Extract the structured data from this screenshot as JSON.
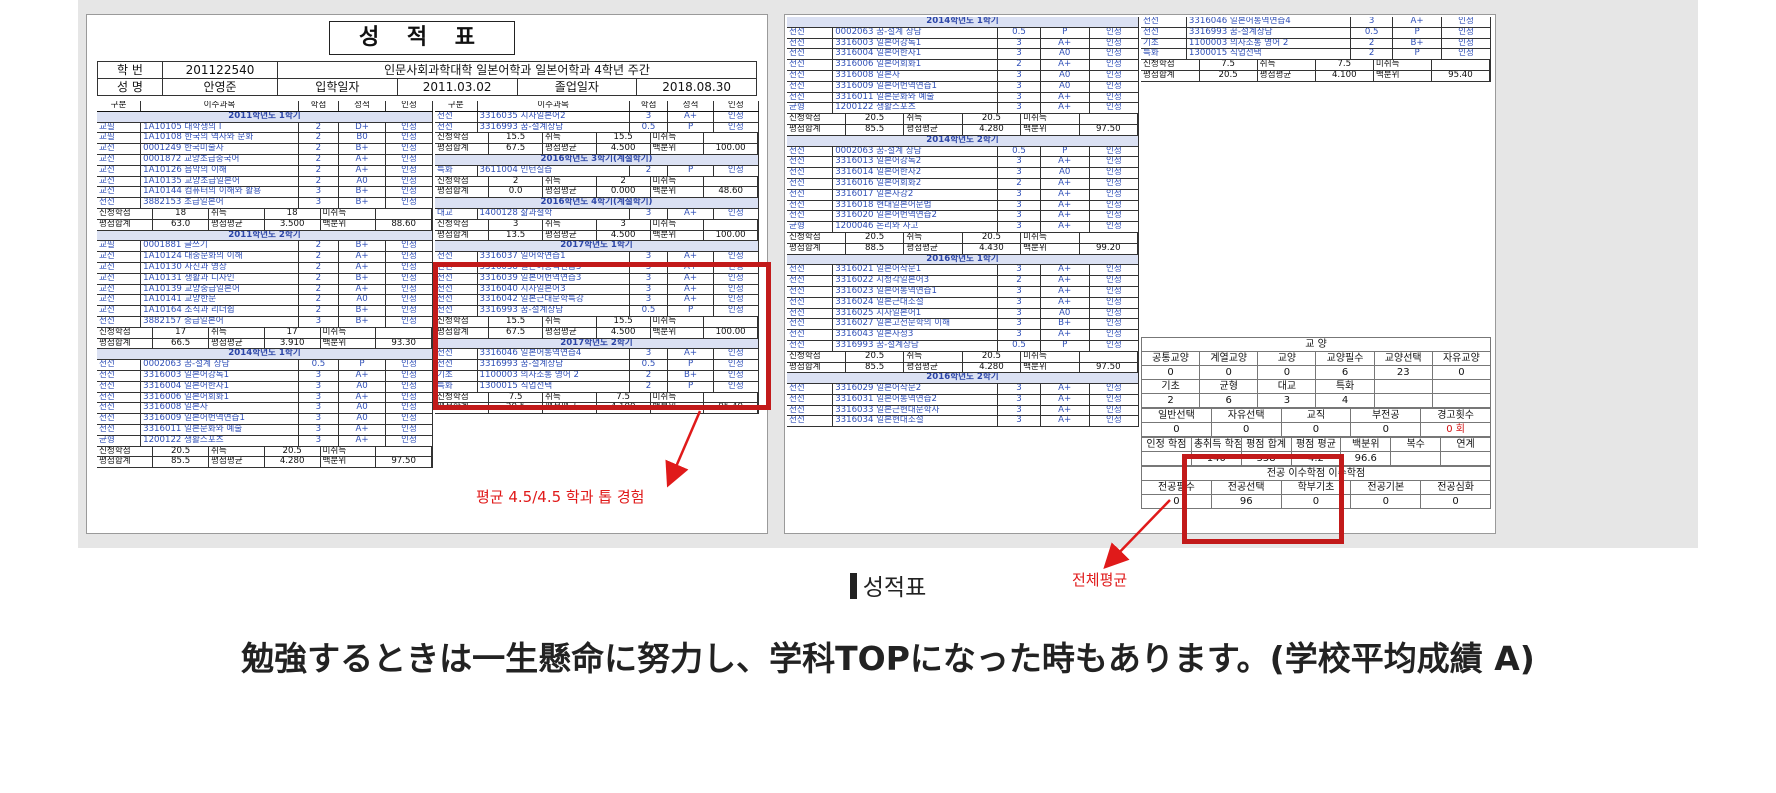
{
  "sheet_title": "성 적 표",
  "info": {
    "row1": [
      "학 번",
      "201122540",
      "인문사회과학대학 일본어학과 일본어학과 4학년 주간"
    ],
    "row2": [
      "성 명",
      "안영준",
      "입학일자",
      "2011.03.02",
      "졸업일자",
      "2018.08.30"
    ]
  },
  "col_headers": [
    "구분",
    "이수과목",
    "학점",
    "성적",
    "인정"
  ],
  "left_a": [
    {
      "t": "sem",
      "v": "2011학년도 1학기"
    },
    {
      "t": "c",
      "v": [
        "교필",
        "1A10105 대학생의 I",
        "2",
        "D+",
        "인정"
      ]
    },
    {
      "t": "c",
      "v": [
        "교필",
        "1A10108 한국의 역사와 문화",
        "2",
        "B0",
        "인정"
      ]
    },
    {
      "t": "c",
      "v": [
        "교선",
        "0001249 한국미술사",
        "2",
        "B+",
        "인정"
      ]
    },
    {
      "t": "c",
      "v": [
        "교선",
        "0001872 교양초급중국어",
        "2",
        "A+",
        "인정"
      ]
    },
    {
      "t": "c",
      "v": [
        "교선",
        "1A10126 음악의 이해",
        "2",
        "A+",
        "인정"
      ]
    },
    {
      "t": "c",
      "v": [
        "교선",
        "1A10135 교양초급일본어",
        "2",
        "A0",
        "인정"
      ]
    },
    {
      "t": "c",
      "v": [
        "교선",
        "1A10144 컴퓨터의 이해와 활용",
        "3",
        "B+",
        "인정"
      ]
    },
    {
      "t": "c",
      "v": [
        "전선",
        "3882153 초급일본어",
        "3",
        "B+",
        "인정"
      ]
    },
    {
      "t": "s",
      "v": [
        "신청학점",
        "18",
        "취득",
        "18",
        "미취득",
        ""
      ]
    },
    {
      "t": "s",
      "v": [
        "평점합계",
        "63.0",
        "평점평균",
        "3.500",
        "백분위",
        "88.60"
      ]
    },
    {
      "t": "sem",
      "v": "2011학년도 2학기"
    },
    {
      "t": "c",
      "v": [
        "교필",
        "0001881 글쓰기",
        "2",
        "B+",
        "인정"
      ]
    },
    {
      "t": "c",
      "v": [
        "교선",
        "1A10124 대중문화의 이해",
        "2",
        "A+",
        "인정"
      ]
    },
    {
      "t": "c",
      "v": [
        "교선",
        "1A10130 사진과 영상",
        "2",
        "A+",
        "인정"
      ]
    },
    {
      "t": "c",
      "v": [
        "교선",
        "1A10131 생활과 디자인",
        "2",
        "B+",
        "인정"
      ]
    },
    {
      "t": "c",
      "v": [
        "교선",
        "1A10139 교양중급일본어",
        "2",
        "A+",
        "인정"
      ]
    },
    {
      "t": "c",
      "v": [
        "교선",
        "1A10141 교양한문",
        "2",
        "A0",
        "인정"
      ]
    },
    {
      "t": "c",
      "v": [
        "교선",
        "1A10164 조직과 리더쉽",
        "2",
        "B+",
        "인정"
      ]
    },
    {
      "t": "c",
      "v": [
        "전선",
        "3882157 중급일본어",
        "3",
        "B+",
        "인정"
      ]
    },
    {
      "t": "s",
      "v": [
        "신청학점",
        "17",
        "취득",
        "17",
        "미취득",
        ""
      ]
    },
    {
      "t": "s",
      "v": [
        "평점합계",
        "66.5",
        "평점평균",
        "3.910",
        "백분위",
        "93.30"
      ]
    },
    {
      "t": "sem",
      "v": "2014학년도 1학기"
    },
    {
      "t": "c",
      "v": [
        "전선",
        "0002063 꿈-설계 상담",
        "0.5",
        "P",
        "인정"
      ]
    },
    {
      "t": "c",
      "v": [
        "전선",
        "3316003 일본어강독1",
        "3",
        "A+",
        "인정"
      ]
    },
    {
      "t": "c",
      "v": [
        "전선",
        "3316004 일본어한자1",
        "3",
        "A0",
        "인정"
      ]
    },
    {
      "t": "c",
      "v": [
        "전선",
        "3316006 일본어회화1",
        "3",
        "A+",
        "인정"
      ]
    },
    {
      "t": "c",
      "v": [
        "전선",
        "3316008 일본사",
        "3",
        "A0",
        "인정"
      ]
    },
    {
      "t": "c",
      "v": [
        "전선",
        "3316009 일본어번역연습1",
        "3",
        "A0",
        "인정"
      ]
    },
    {
      "t": "c",
      "v": [
        "전선",
        "3316011 일본문화와 예술",
        "3",
        "A+",
        "인정"
      ]
    },
    {
      "t": "c",
      "v": [
        "균형",
        "1200122 생활스포츠",
        "3",
        "A+",
        "인정"
      ]
    },
    {
      "t": "s",
      "v": [
        "신청학점",
        "20.5",
        "취득",
        "20.5",
        "미취득",
        ""
      ]
    },
    {
      "t": "s",
      "v": [
        "평점합계",
        "85.5",
        "평점평균",
        "4.280",
        "백분위",
        "97.50"
      ]
    }
  ],
  "left_b": [
    {
      "t": "c",
      "v": [
        "전선",
        "3316035 시사일본어2",
        "3",
        "A+",
        "인정"
      ]
    },
    {
      "t": "c",
      "v": [
        "전선",
        "3316993 꿈-설계상담",
        "0.5",
        "P",
        "인정"
      ]
    },
    {
      "t": "s",
      "v": [
        "신청학점",
        "15.5",
        "취득",
        "15.5",
        "미취득",
        ""
      ]
    },
    {
      "t": "s",
      "v": [
        "평점합계",
        "67.5",
        "평점평균",
        "4.500",
        "백분위",
        "100.00"
      ]
    },
    {
      "t": "sem",
      "v": "2016학년도 3학기(계절학기)"
    },
    {
      "t": "c",
      "v": [
        "특화",
        "3611004 인턴실습",
        "2",
        "P",
        "인정"
      ]
    },
    {
      "t": "s",
      "v": [
        "신청학점",
        "2",
        "취득",
        "2",
        "미취득",
        ""
      ]
    },
    {
      "t": "s",
      "v": [
        "평점합계",
        "0.0",
        "평점평균",
        "0.000",
        "백분위",
        "48.60"
      ]
    },
    {
      "t": "sem",
      "v": "2016학년도 4학기(계절학기)"
    },
    {
      "t": "c",
      "v": [
        "대교",
        "1400128 삶과철학",
        "3",
        "A+",
        "인정"
      ]
    },
    {
      "t": "s",
      "v": [
        "신청학점",
        "3",
        "취득",
        "3",
        "미취득",
        ""
      ]
    },
    {
      "t": "s",
      "v": [
        "평점합계",
        "13.5",
        "평점평균",
        "4.500",
        "백분위",
        "100.00"
      ]
    },
    {
      "t": "sem",
      "v": "2017학년도 1학기"
    },
    {
      "t": "c",
      "v": [
        "전선",
        "3316037 일어학연습1",
        "3",
        "A+",
        "인정"
      ]
    },
    {
      "t": "c",
      "v": [
        "전선",
        "3316038 일본어통역연습3",
        "3",
        "A+",
        "인정"
      ]
    },
    {
      "t": "c",
      "v": [
        "전선",
        "3316039 일본어번역연습3",
        "3",
        "A+",
        "인정"
      ]
    },
    {
      "t": "c",
      "v": [
        "전선",
        "3316040 시사일본어3",
        "3",
        "A+",
        "인정"
      ]
    },
    {
      "t": "c",
      "v": [
        "전선",
        "3316042 일본근대문학특강",
        "3",
        "A+",
        "인정"
      ]
    },
    {
      "t": "c",
      "v": [
        "전선",
        "3316993 꿈-설계상담",
        "0.5",
        "P",
        "인정"
      ]
    },
    {
      "t": "s",
      "v": [
        "신청학점",
        "15.5",
        "취득",
        "15.5",
        "미취득",
        ""
      ]
    },
    {
      "t": "s",
      "v": [
        "평점합계",
        "67.5",
        "평점평균",
        "4.500",
        "백분위",
        "100.00"
      ]
    },
    {
      "t": "sem",
      "v": "2017학년도 2학기"
    },
    {
      "t": "c",
      "v": [
        "전선",
        "3316046 일본어통역연습4",
        "3",
        "A+",
        "인정"
      ]
    },
    {
      "t": "c",
      "v": [
        "전선",
        "3316993 꿈-설계상담",
        "0.5",
        "P",
        "인정"
      ]
    },
    {
      "t": "c",
      "v": [
        "기초",
        "1100003 의사소통 영어 2",
        "2",
        "B+",
        "인정"
      ]
    },
    {
      "t": "c",
      "v": [
        "특화",
        "1300015 직업선택",
        "2",
        "P",
        "인정"
      ]
    },
    {
      "t": "s",
      "v": [
        "신청학점",
        "7.5",
        "취득",
        "7.5",
        "미취득",
        ""
      ]
    },
    {
      "t": "s",
      "v": [
        "평점합계",
        "20.5",
        "평점평균",
        "4.100",
        "백분위",
        "95.40"
      ]
    }
  ],
  "right_a": [
    {
      "t": "sem",
      "v": "2014학년도 1학기"
    },
    {
      "t": "c",
      "v": [
        "전선",
        "0002063 꿈-설계 상담",
        "0.5",
        "P",
        "인정"
      ]
    },
    {
      "t": "c",
      "v": [
        "전선",
        "3316003 일본어강독1",
        "3",
        "A+",
        "인정"
      ]
    },
    {
      "t": "c",
      "v": [
        "전선",
        "3316004 일본어한자1",
        "3",
        "A0",
        "인정"
      ]
    },
    {
      "t": "c",
      "v": [
        "전선",
        "3316006 일본어회화1",
        "2",
        "A+",
        "인정"
      ]
    },
    {
      "t": "c",
      "v": [
        "전선",
        "3316008 일본사",
        "3",
        "A0",
        "인정"
      ]
    },
    {
      "t": "c",
      "v": [
        "전선",
        "3316009 일본어번역연습1",
        "3",
        "A0",
        "인정"
      ]
    },
    {
      "t": "c",
      "v": [
        "전선",
        "3316011 일본문화와 예술",
        "3",
        "A+",
        "인정"
      ]
    },
    {
      "t": "c",
      "v": [
        "균형",
        "1200122 생활스포츠",
        "3",
        "A+",
        "인정"
      ]
    },
    {
      "t": "s",
      "v": [
        "신청학점",
        "20.5",
        "취득",
        "20.5",
        "미취득",
        ""
      ]
    },
    {
      "t": "s",
      "v": [
        "평점합계",
        "85.5",
        "평점평균",
        "4.280",
        "백분위",
        "97.50"
      ]
    },
    {
      "t": "sem",
      "v": "2014학년도 2학기"
    },
    {
      "t": "c",
      "v": [
        "전선",
        "0002063 꿈-설계 상담",
        "0.5",
        "P",
        "인정"
      ]
    },
    {
      "t": "c",
      "v": [
        "전선",
        "3316013 일본어강독2",
        "3",
        "A+",
        "인정"
      ]
    },
    {
      "t": "c",
      "v": [
        "전선",
        "3316014 일본어한자2",
        "3",
        "A0",
        "인정"
      ]
    },
    {
      "t": "c",
      "v": [
        "전선",
        "3316016 일본어회화2",
        "2",
        "A+",
        "인정"
      ]
    },
    {
      "t": "c",
      "v": [
        "전선",
        "3316017 일본사강2",
        "3",
        "A+",
        "인정"
      ]
    },
    {
      "t": "c",
      "v": [
        "전선",
        "3316018 현대일본어문법",
        "3",
        "A+",
        "인정"
      ]
    },
    {
      "t": "c",
      "v": [
        "전선",
        "3316020 일본어번역연습2",
        "3",
        "A+",
        "인정"
      ]
    },
    {
      "t": "c",
      "v": [
        "균형",
        "1200046 논리와 사고",
        "3",
        "A+",
        "인정"
      ]
    },
    {
      "t": "s",
      "v": [
        "신청학점",
        "20.5",
        "취득",
        "20.5",
        "미취득",
        ""
      ]
    },
    {
      "t": "s",
      "v": [
        "평점합계",
        "88.5",
        "평점평균",
        "4.430",
        "백분위",
        "99.20"
      ]
    },
    {
      "t": "sem",
      "v": "2016학년도 1학기"
    },
    {
      "t": "c",
      "v": [
        "전선",
        "3316021 일본어작문1",
        "3",
        "A+",
        "인정"
      ]
    },
    {
      "t": "c",
      "v": [
        "전선",
        "3316022 시청각일본어3",
        "2",
        "A+",
        "인정"
      ]
    },
    {
      "t": "c",
      "v": [
        "전선",
        "3316023 일본어통역연습1",
        "3",
        "A+",
        "인정"
      ]
    },
    {
      "t": "c",
      "v": [
        "전선",
        "3316024 일본근대소설",
        "3",
        "A+",
        "인정"
      ]
    },
    {
      "t": "c",
      "v": [
        "전선",
        "3316025 시사일본어1",
        "3",
        "A0",
        "인정"
      ]
    },
    {
      "t": "c",
      "v": [
        "전선",
        "3316027 일본고전문학의 이해",
        "3",
        "B+",
        "인정"
      ]
    },
    {
      "t": "c",
      "v": [
        "전선",
        "3316043 일본사정3",
        "3",
        "A+",
        "인정"
      ]
    },
    {
      "t": "c",
      "v": [
        "전선",
        "3316993 꿈-설계상담",
        "0.5",
        "P",
        "인정"
      ]
    },
    {
      "t": "s",
      "v": [
        "신청학점",
        "20.5",
        "취득",
        "20.5",
        "미취득",
        ""
      ]
    },
    {
      "t": "s",
      "v": [
        "평점합계",
        "85.5",
        "평점평균",
        "4.280",
        "백분위",
        "97.50"
      ]
    },
    {
      "t": "sem",
      "v": "2016학년도 2학기"
    },
    {
      "t": "c",
      "v": [
        "전선",
        "3316029 일본어작문2",
        "3",
        "A+",
        "인정"
      ]
    },
    {
      "t": "c",
      "v": [
        "전선",
        "3316031 일본어통역연습2",
        "3",
        "A+",
        "인정"
      ]
    },
    {
      "t": "c",
      "v": [
        "전선",
        "3316033 일본근현대문학사",
        "3",
        "A+",
        "인정"
      ]
    },
    {
      "t": "c",
      "v": [
        "전선",
        "3316034 일본현대소설",
        "3",
        "A+",
        "인정"
      ]
    }
  ],
  "right_b": [
    {
      "t": "c",
      "v": [
        "전선",
        "3316046 일본어통역연습4",
        "3",
        "A+",
        "인정"
      ]
    },
    {
      "t": "c",
      "v": [
        "전선",
        "3316993 꿈-설계상담",
        "0.5",
        "P",
        "인정"
      ]
    },
    {
      "t": "c",
      "v": [
        "기초",
        "1100003 의사소통 영어 2",
        "2",
        "B+",
        "인정"
      ]
    },
    {
      "t": "c",
      "v": [
        "특화",
        "1300015 직업선택",
        "2",
        "P",
        "인정"
      ]
    },
    {
      "t": "s",
      "v": [
        "신청학점",
        "7.5",
        "취득",
        "7.5",
        "미취득",
        ""
      ]
    },
    {
      "t": "s",
      "v": [
        "평점합계",
        "20.5",
        "평점평균",
        "4.100",
        "백분위",
        "95.40"
      ]
    }
  ],
  "summary": {
    "title": "교 양",
    "r1h": [
      "공통교양",
      "계열교양",
      "교양",
      "교양필수",
      "교양선택",
      "자유교양"
    ],
    "r1v": [
      "0",
      "0",
      "0",
      "6",
      "23",
      "0"
    ],
    "r2h": [
      "기초",
      "균형",
      "대교",
      "특화",
      "",
      ""
    ],
    "r2v": [
      "2",
      "6",
      "3",
      "4",
      "",
      ""
    ],
    "r3h": [
      "일반선택",
      "자유선택",
      "교직",
      "부전공",
      "경고횟수"
    ],
    "r3v": [
      "0",
      "0",
      "0",
      "0",
      "0 회"
    ],
    "r4h": [
      "인정 학점",
      "총취득 학점",
      "평점 합계",
      "평점 평균",
      "백분위",
      "복수",
      "연계"
    ],
    "r4v": [
      "",
      "140",
      "558",
      "4.2",
      "96.6",
      "",
      ""
    ],
    "r5title": "전공 이수학점 이수학점",
    "r5h": [
      "전공필수",
      "전공선택",
      "학부기초",
      "전공기본",
      "전공심화"
    ],
    "r5v": [
      "0",
      "96",
      "0",
      "0",
      "0"
    ]
  },
  "notes": {
    "left_note": "평균 4.5/4.5 학과 톱 경험",
    "right_note": "전체평균"
  },
  "caption": "성적표",
  "jp_line": "勉強するときは一生懸命に努力し、学科TOPになった時もあります。(学校平均成績 A)",
  "colors": {
    "highlight": "#c21a1a",
    "note": "#e01a1a",
    "ink": "#3050b8"
  }
}
